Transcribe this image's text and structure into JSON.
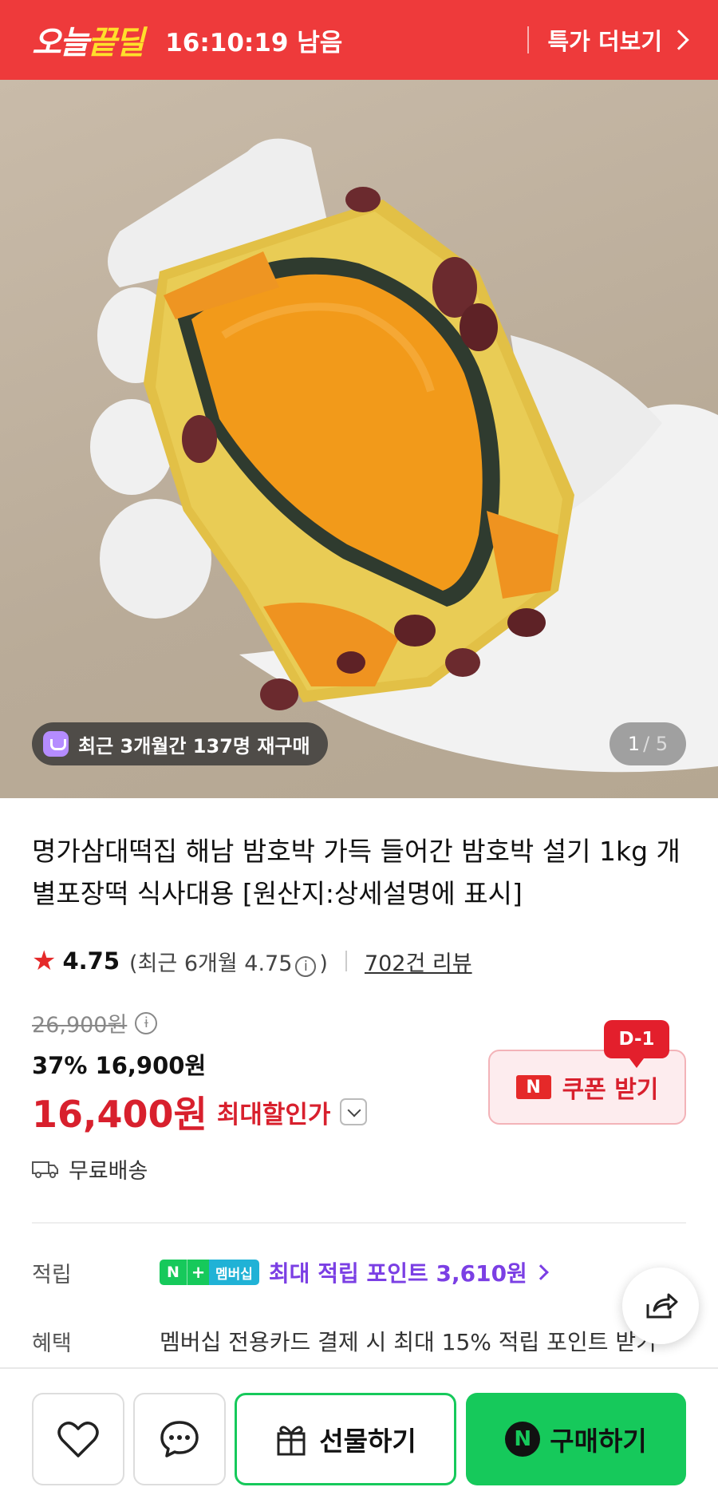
{
  "deal_bar": {
    "logo_prefix": "오늘",
    "logo_highlight": "끝딜",
    "timer": "16:10:19 남음",
    "more_label": "특가 더보기"
  },
  "hero": {
    "rebuy_badge": "최근 3개월간 137명 재구매",
    "pager_current": "1",
    "pager_total": "/ 5"
  },
  "product": {
    "title": "명가삼대떡집 해남 밤호박 가득 들어간 밤호박 설기 1kg 개별포장떡 식사대용 [원산지:상세설명에 표시]",
    "rating": "4.75",
    "rating_recent_prefix": "(최근 6개월 4.75",
    "rating_recent_suffix": ")",
    "reviews": "702건 리뷰"
  },
  "price": {
    "original": "26,900원",
    "discount_rate": "37%",
    "discount_price": "16,900원",
    "final_price": "16,400원",
    "final_label": "최대할인가"
  },
  "coupon": {
    "dday": "D-1",
    "n_badge": "N",
    "label": "쿠폰 받기"
  },
  "shipping": {
    "label": "무료배송"
  },
  "points": {
    "label": "적립",
    "badge_n": "N",
    "badge_plus": "+",
    "badge_membership": "멤버십",
    "text": "최대 적립 포인트 3,610원"
  },
  "benefit": {
    "label": "혜택",
    "text": "멤버십 전용카드 결제 시 최대 15% 적립 포인트 받기"
  },
  "bottom_bar": {
    "gift_label": "선물하기",
    "buy_n": "N",
    "buy_label": "구매하기"
  },
  "colors": {
    "deal_red": "#ee3a3b",
    "price_red": "#d8202d",
    "naver_green": "#16c95b",
    "point_purple": "#7b3fe4"
  }
}
